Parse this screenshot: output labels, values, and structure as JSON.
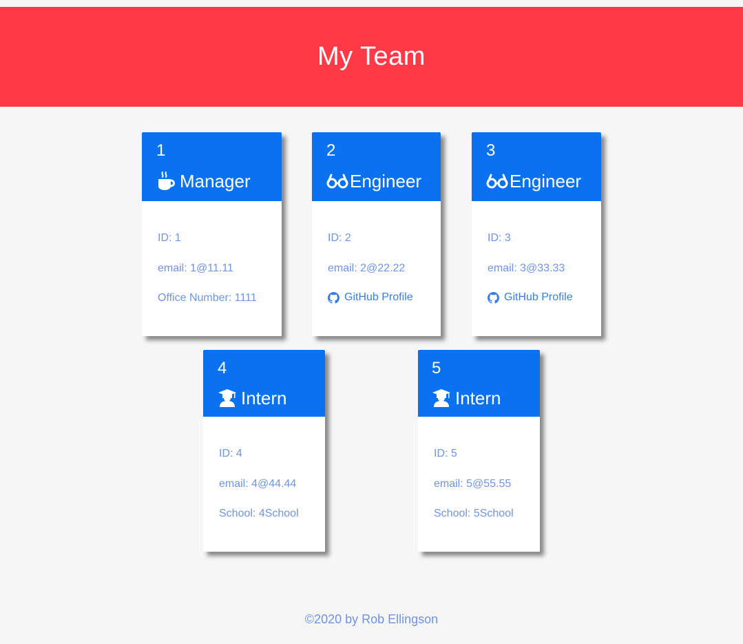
{
  "header": {
    "title": "My Team"
  },
  "team": [
    {
      "name": "1",
      "role": "Manager",
      "icon": "coffee-icon",
      "id_line": "ID: 1",
      "email_line": "email: 1@11.11",
      "extra_line": "Office Number: 1111"
    },
    {
      "name": "2",
      "role": "Engineer",
      "icon": "glasses-icon",
      "id_line": "ID: 2",
      "email_line": "email: 2@22.22",
      "extra_line": "GitHub Profile"
    },
    {
      "name": "3",
      "role": "Engineer",
      "icon": "glasses-icon",
      "id_line": "ID: 3",
      "email_line": "email: 3@33.33",
      "extra_line": "GitHub Profile"
    },
    {
      "name": "4",
      "role": "Intern",
      "icon": "graduate-icon",
      "id_line": "ID: 4",
      "email_line": "email: 4@44.44",
      "extra_line": "School: 4School"
    },
    {
      "name": "5",
      "role": "Intern",
      "icon": "graduate-icon",
      "id_line": "ID: 5",
      "email_line": "email: 5@55.55",
      "extra_line": "School: 5School"
    }
  ],
  "footer": {
    "text": "©2020 by Rob Ellingson"
  },
  "colors": {
    "header_bg": "#ff3a46",
    "card_header_bg": "#0a72f0",
    "body_text": "#6f93e6",
    "link": "#3b7ee8",
    "page_bg": "#f6f6f6"
  }
}
